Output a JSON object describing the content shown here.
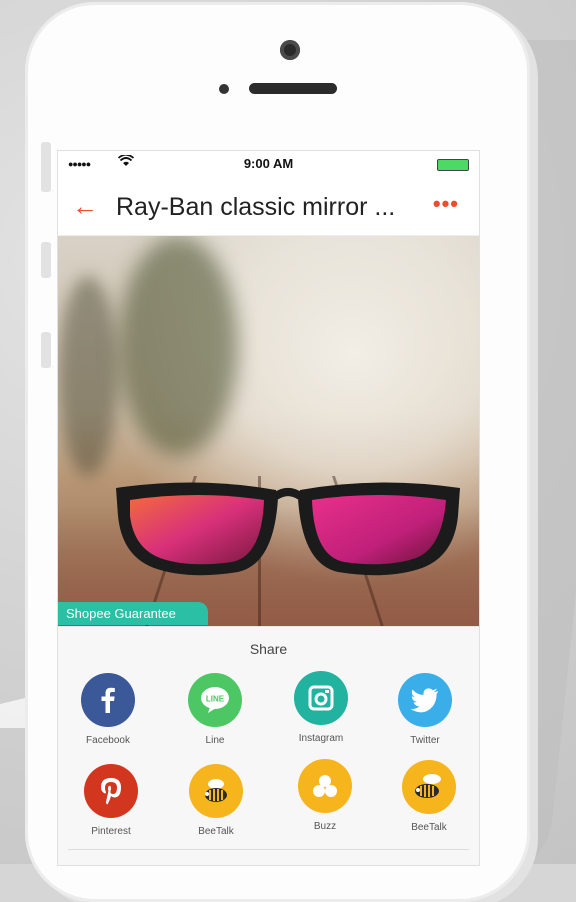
{
  "status_bar": {
    "time": "9:00 AM",
    "signal": "●●●●●"
  },
  "nav": {
    "title": "Ray-Ban classic mirror ...",
    "more": "•••",
    "back": "←"
  },
  "product": {
    "badge": "Shopee Guarantee"
  },
  "share": {
    "title": "Share",
    "items": [
      {
        "label": "Facebook",
        "icon": "facebook-icon",
        "color": "#3b5998"
      },
      {
        "label": "Line",
        "icon": "line-icon",
        "color": "#4cc764"
      },
      {
        "label": "Instagram",
        "icon": "instagram-icon",
        "color": "#21b3a0"
      },
      {
        "label": "Twitter",
        "icon": "twitter-icon",
        "color": "#3aaee8"
      },
      {
        "label": "Pinterest",
        "icon": "pinterest-icon",
        "color": "#d3361f"
      },
      {
        "label": "BeeTalk",
        "icon": "beetalk-icon",
        "color": "#f7b51d"
      },
      {
        "label": "Buzz",
        "icon": "buzz-icon",
        "color": "#f7b51d"
      },
      {
        "label": "BeeTalk",
        "icon": "beetalk-icon",
        "color": "#f7b51d"
      }
    ]
  },
  "colors": {
    "accent": "#ee4d2d",
    "guarantee": "#2bbfa5"
  }
}
